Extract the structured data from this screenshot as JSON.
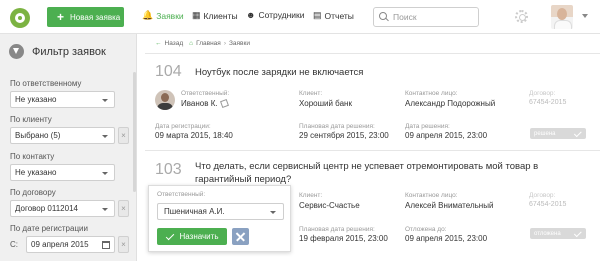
{
  "header": {
    "new_request_label": "Новая заявка",
    "nav": [
      {
        "label": "Заявки",
        "icon": "bell-icon",
        "active": true
      },
      {
        "label": "Клиенты",
        "icon": "building-icon",
        "active": false
      },
      {
        "label": "Сотрудники",
        "icon": "people-icon",
        "active": false
      },
      {
        "label": "Отчеты",
        "icon": "document-icon",
        "active": false
      }
    ],
    "search_placeholder": "Поиск"
  },
  "sidebar": {
    "title": "Фильтр заявок",
    "filters": [
      {
        "label": "По ответственному",
        "value": "Не указано"
      },
      {
        "label": "По клиенту",
        "value": "Выбрано  (5)"
      },
      {
        "label": "По контакту",
        "value": "Не указано"
      },
      {
        "label": "По договору",
        "value": "Договор 0112014"
      }
    ],
    "date_filter": {
      "label": "По дате регистрации",
      "prefix": "С:",
      "value": "09 апреля 2015"
    },
    "clear_symbol": "×"
  },
  "breadcrumb": {
    "back": "Назад",
    "home": "Главная",
    "current": "Заявки"
  },
  "tickets": [
    {
      "number": "104",
      "title": "Ноутбук после зарядки не включается",
      "responsible_label": "Ответственный:",
      "responsible": "Иванов К.",
      "client_label": "Клиент:",
      "client": "Хороший банк",
      "contact_label": "Контактное лицо:",
      "contact": "Александр Подорожный",
      "contract_label": "Договор:",
      "contract": "67454-2015",
      "reg_date_label": "Дата регистрации:",
      "reg_date": "09 марта 2015, 18:40",
      "planned_label": "Плановая дата решения:",
      "planned": "29 сентября 2015, 23:00",
      "solved_label": "Дата решения:",
      "solved": "09 апреля 2015, 23:00",
      "status": "решена"
    },
    {
      "number": "103",
      "title_line1": "Что делать, если сервисный центр не успевает отремонтировать мой товар в",
      "title_line2": "гарантийный период?",
      "client_label": "Клиент:",
      "client": "Сервис-Счастье",
      "contact_label": "Контактное лицо:",
      "contact": "Алексей Внимательный",
      "contract_label": "Договор:",
      "contract": "67454-2015",
      "planned_label": "Плановая дата решения:",
      "planned": "19 февраля 2015, 23:00",
      "postponed_label": "Отложена до:",
      "postponed": "09 апреля 2015, 23:00",
      "status": "отложена"
    }
  ],
  "assign_popup": {
    "label": "Ответственный:",
    "value": "Пшеничная А.И.",
    "assign_label": "Назначить"
  },
  "colors": {
    "accent": "#4caf50",
    "cancel": "#8aa1c1",
    "status_pill": "#d9d9d9"
  }
}
